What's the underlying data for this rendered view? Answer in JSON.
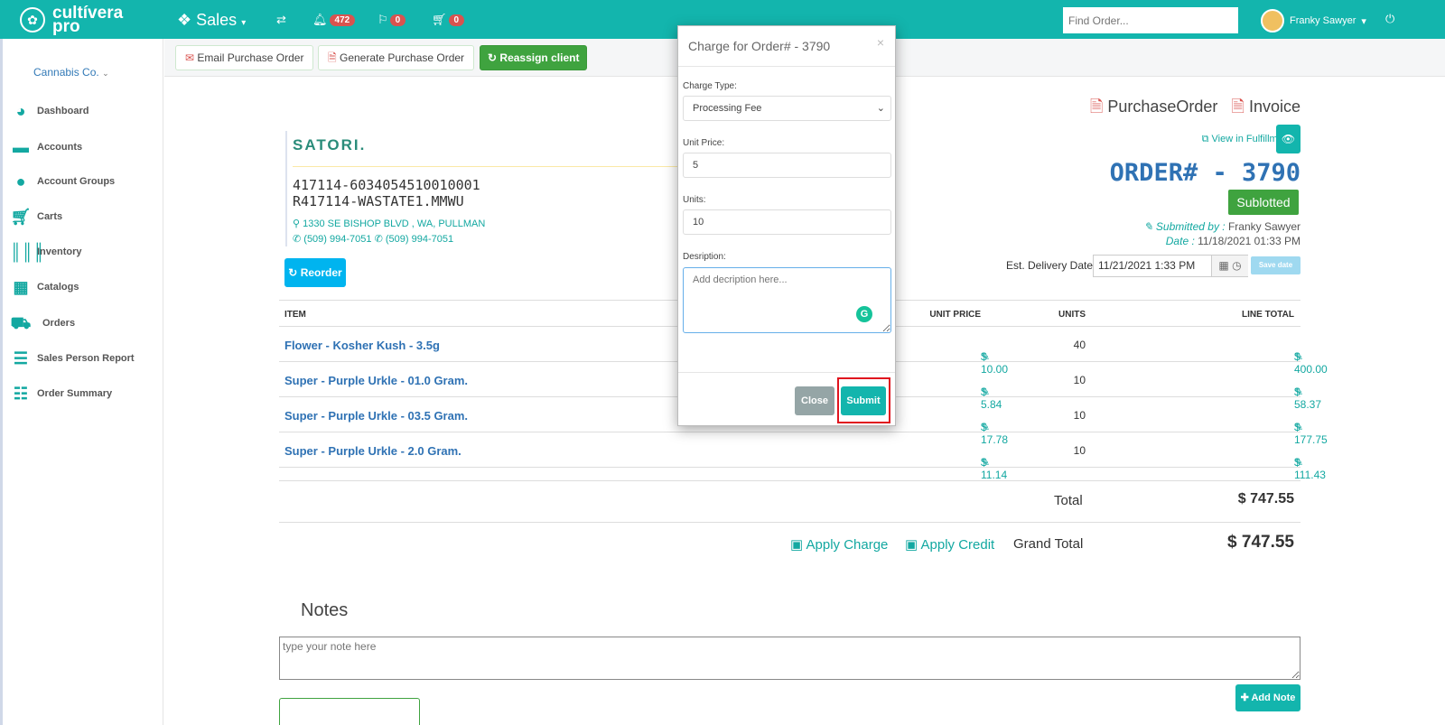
{
  "header": {
    "logo_line1": "cultívera",
    "logo_line2": "pro",
    "module": "Sales",
    "notifications": "472",
    "flags": "0",
    "cart": "0",
    "search_placeholder": "Find Order...",
    "user": "Franky Sawyer"
  },
  "sidebar": {
    "client": "Cannabis Co.",
    "items": [
      {
        "label": "Dashboard",
        "icon": "pie-chart-icon"
      },
      {
        "label": "Accounts",
        "icon": "briefcase-icon"
      },
      {
        "label": "Account Groups",
        "icon": "users-icon"
      },
      {
        "label": "Carts",
        "icon": "cart-icon"
      },
      {
        "label": "Inventory",
        "icon": "barcode-icon"
      },
      {
        "label": "Catalogs",
        "icon": "grid-icon"
      },
      {
        "label": "Orders",
        "icon": "cart-outline-icon"
      },
      {
        "label": "Sales Person Report",
        "icon": "table-icon"
      },
      {
        "label": "Order Summary",
        "icon": "list-icon"
      }
    ]
  },
  "toolbar": {
    "email": "Email Purchase Order",
    "generate": "Generate Purchase Order",
    "reassign": "Reassign client"
  },
  "vendor": {
    "name": "SATORI.",
    "license1": "417114-6034054510010001",
    "license2": "R417114-WASTATE1.MMWU",
    "address": "1330 SE BISHOP BLVD , WA, PULLMAN",
    "phone1": "(509) 994-7051",
    "phone2": "(509) 994-7051",
    "reorder": "Reorder"
  },
  "order": {
    "purchase_order": "PurchaseOrder",
    "invoice": "Invoice",
    "view_fulfillment": "View in Fulfillment",
    "number": "ORDER# - 3790",
    "status": "Sublotted",
    "submitted_label": "Submitted by :",
    "submitted_by": "Franky Sawyer",
    "date_label": "Date :",
    "date": "11/18/2021 01:33 PM",
    "delivery_label": "Est. Delivery Date",
    "delivery": "11/21/2021 1:33 PM",
    "save_date": "Save date"
  },
  "table": {
    "headers": [
      "ITEM",
      "UNIT PRICE",
      "UNITS",
      "LINE TOTAL"
    ],
    "rows": [
      {
        "item": "Flower - Kosher Kush - 3.5g",
        "price": "$ 10.00",
        "units": "40",
        "total": "$ 400.00"
      },
      {
        "item": "Super - Purple Urkle - 01.0 Gram.",
        "price": "$ 5.84",
        "units": "10",
        "total": "$ 58.37"
      },
      {
        "item": "Super - Purple Urkle - 03.5 Gram.",
        "price": "$ 17.78",
        "units": "10",
        "total": "$ 177.75"
      },
      {
        "item": "Super - Purple Urkle - 2.0 Gram.",
        "price": "$ 11.14",
        "units": "10",
        "total": "$ 111.43"
      }
    ]
  },
  "totals": {
    "total_label": "Total",
    "total": "$ 747.55",
    "apply_charge": "Apply Charge",
    "apply_credit": "Apply Credit",
    "grand_label": "Grand Total",
    "grand": "$ 747.55"
  },
  "notes": {
    "title": "Notes",
    "placeholder": "type your note here",
    "add": "Add Note"
  },
  "modal": {
    "title": "Charge for Order# - 3790",
    "charge_type_label": "Charge Type:",
    "charge_type": "Processing Fee",
    "unit_price_label": "Unit Price:",
    "unit_price": "5",
    "units_label": "Units:",
    "units": "10",
    "description_label": "Desription:",
    "description_placeholder": "Add decription here...",
    "close": "Close",
    "submit": "Submit"
  }
}
